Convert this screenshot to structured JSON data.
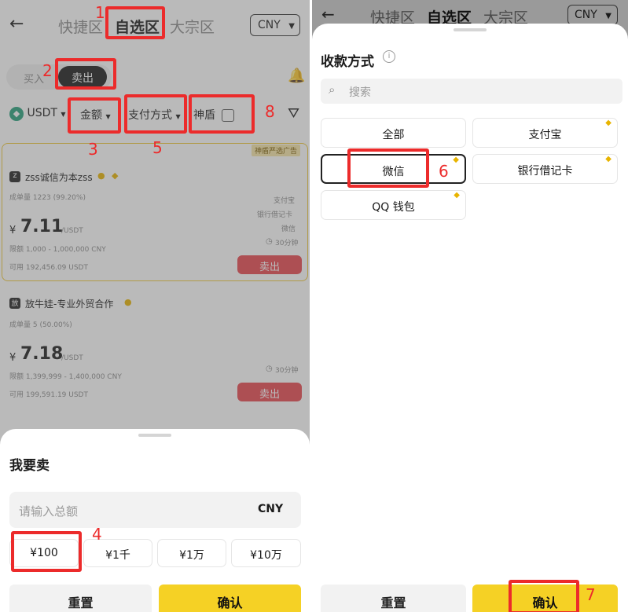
{
  "left": {
    "header": {
      "back_icon": "back-arrow-icon",
      "tabs": [
        "快捷区",
        "自选区",
        "大宗区"
      ],
      "currency": "CNY"
    },
    "trade_toggle": {
      "buy": "买入",
      "sell": "卖出"
    },
    "filters": {
      "asset": "USDT",
      "amount": "金额",
      "payment": "支付方式",
      "shield": "神盾"
    },
    "listings": [
      {
        "badge": "神盾严选广告",
        "avatar": "z",
        "name": "zss诚信为本zss",
        "stats": "成单量 1223 (99.20%)",
        "currency_symbol": "¥",
        "price": "7.11",
        "unit": "/USDT",
        "limit": "限额 1,000 - 1,000,000 CNY",
        "available": "可用 192,456.09 USDT",
        "methods": [
          "支付宝",
          "银行借记卡",
          "微信"
        ],
        "time": "30分钟",
        "action": "卖出"
      },
      {
        "avatar": "放",
        "name": "放牛娃-专业外贸合作",
        "stats": "成单量 5 (50.00%)",
        "currency_symbol": "¥",
        "price": "7.18",
        "unit": "/USDT",
        "limit": "限额 1,399,999 - 1,400,000 CNY",
        "available": "可用 199,591.19 USDT",
        "time": "30分钟",
        "action": "卖出"
      }
    ],
    "sheet": {
      "title": "我要卖",
      "placeholder": "请输入总额",
      "currency": "CNY",
      "presets": [
        "¥100",
        "¥1千",
        "¥1万",
        "¥10万"
      ],
      "reset": "重置",
      "confirm": "确认"
    },
    "annotations": [
      "1",
      "2",
      "3",
      "4",
      "5",
      "8"
    ]
  },
  "right": {
    "header": {
      "tabs": [
        "快捷区",
        "自选区",
        "大宗区"
      ],
      "currency": "CNY"
    },
    "sheet": {
      "title": "收款方式",
      "search_placeholder": "搜索",
      "options": [
        "全部",
        "支付宝",
        "微信",
        "银行借记卡",
        "QQ 钱包"
      ],
      "reset": "重置",
      "confirm": "确认"
    },
    "annotations": [
      "6",
      "7"
    ]
  }
}
